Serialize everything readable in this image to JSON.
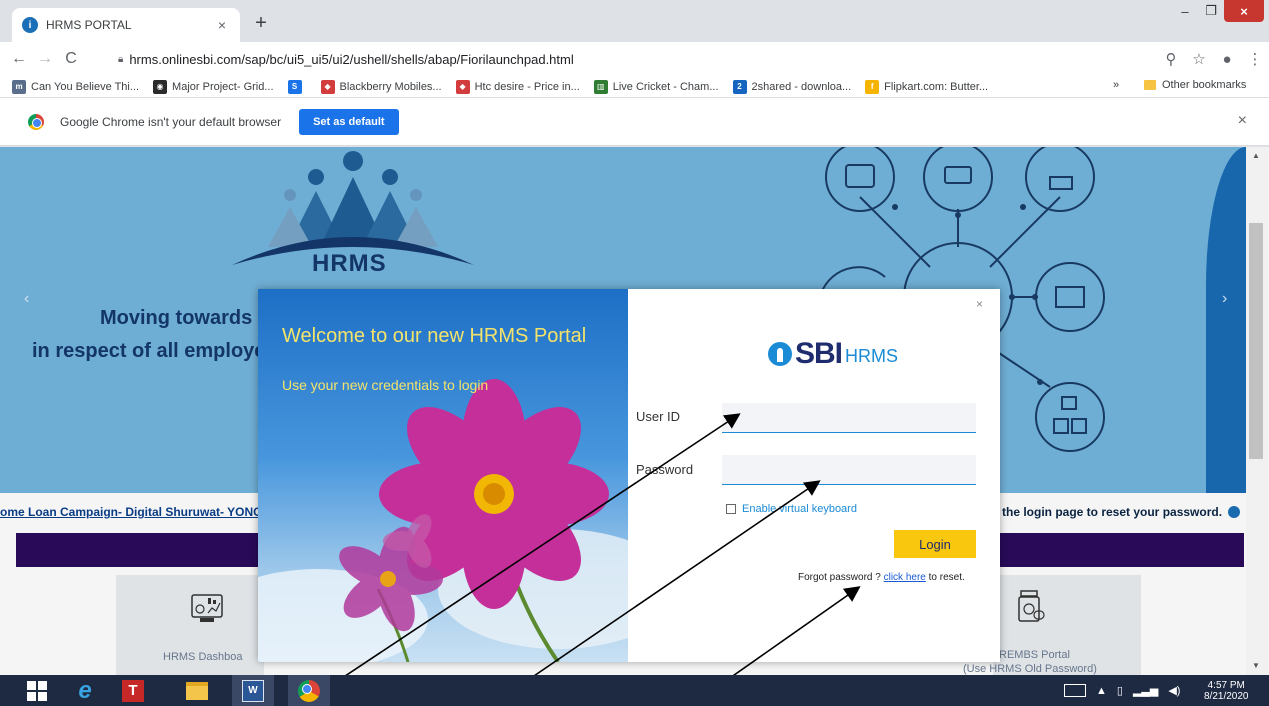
{
  "browser": {
    "tab_title": "HRMS PORTAL",
    "tab_close": "×",
    "new_tab": "+",
    "url": "hrms.onlinesbi.com/sap/bc/ui5_ui5/ui2/ushell/shells/abap/Fiorilaunchpad.html",
    "window_min": "–",
    "window_max": "❐",
    "window_close": "×",
    "back": "←",
    "forward": "→",
    "reload": "C",
    "zoom": "⚲",
    "star": "☆",
    "profile": "●",
    "menu": "⋮"
  },
  "bookmarks": {
    "items": [
      {
        "label": "Can You Believe Thi...",
        "color": "#5a6e8c",
        "glyph": "m"
      },
      {
        "label": "Major Project- Grid...",
        "color": "#2b2b2b",
        "glyph": "◉"
      },
      {
        "label": "",
        "color": "#1a73e8",
        "glyph": "S"
      },
      {
        "label": "Blackberry Mobiles...",
        "color": "#d23c3c",
        "glyph": "◆"
      },
      {
        "label": "Htc desire - Price in...",
        "color": "#d23c3c",
        "glyph": "◆"
      },
      {
        "label": "Live Cricket - Cham...",
        "color": "#2e7d32",
        "glyph": "▥"
      },
      {
        "label": "2shared - downloa...",
        "color": "#1565c0",
        "glyph": "2"
      },
      {
        "label": "Flipkart.com: Butter...",
        "color": "#f6b300",
        "glyph": "f"
      }
    ],
    "overflow": "»",
    "other": "Other bookmarks"
  },
  "infobar": {
    "message": "Google Chrome isn't your default browser",
    "button": "Set as default",
    "close": "×"
  },
  "hero": {
    "logo_text": "HRMS",
    "tagline_1": "Moving towards c",
    "tagline_2": "in respect of all employe",
    "prev": "‹",
    "next": "›"
  },
  "ticker": {
    "left": "ome Loan Campaign- Digital Shuruwat- YONC",
    "right": "the login page to reset your password."
  },
  "cards": {
    "left_label": "HRMS Dashboa",
    "right_label_1": "REMBS Portal",
    "right_label_2": "(Use HRMS Old Password)"
  },
  "modal": {
    "welcome": "Welcome to our new  HRMS Portal",
    "subtitle": "Use your new credentials to login",
    "close": "×",
    "brand": "SBI",
    "brand_suffix": "HRMS",
    "user_label": "User ID",
    "user_value": "",
    "password_label": "Password",
    "password_value": "",
    "virtual_keyboard": "Enable virtual keyboard",
    "login": "Login",
    "forgot_prefix": "Forgot password ? ",
    "forgot_link": "click here",
    "forgot_suffix": " to reset."
  },
  "taskbar": {
    "time": "4:57 PM",
    "date": "8/21/2020"
  }
}
